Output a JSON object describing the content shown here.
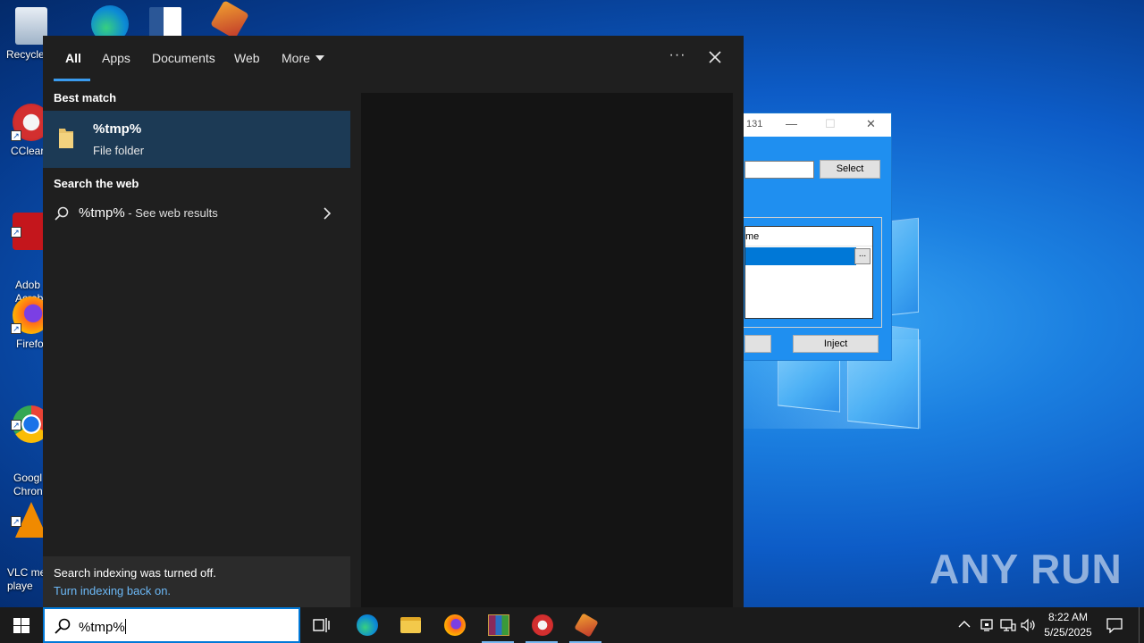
{
  "desktop": {
    "icons": [
      {
        "label": "Recycle"
      },
      {
        "label": "CClear"
      },
      {
        "label": "Adob\nAcrob"
      },
      {
        "label": "Firefo"
      },
      {
        "label": "Googl\nChron"
      },
      {
        "label": "VLC me\nplaye"
      }
    ],
    "watermark": "ANY RUN"
  },
  "dialog": {
    "title_fragment": "131",
    "select_label": "Select",
    "list_header": "me",
    "more_button": "...",
    "inject_label": "Inject"
  },
  "search": {
    "tabs": [
      "All",
      "Apps",
      "Documents",
      "Web",
      "More"
    ],
    "ellipsis": "···",
    "best_match_heading": "Best match",
    "best_match": {
      "title": "%tmp%",
      "subtitle": "File folder"
    },
    "web_heading": "Search the web",
    "web_result": {
      "query": "%tmp%",
      "suffix": " - See web results"
    },
    "indexing_message": "Search indexing was turned off.",
    "indexing_link": "Turn indexing back on.",
    "query": "%tmp%"
  },
  "taskbar": {
    "time": "8:22 AM",
    "date": "5/25/2025"
  },
  "colors": {
    "accent": "#0078d7",
    "panel_bg": "#1f1f1f",
    "selected_bg": "#1c3a55",
    "link": "#6cb8f6"
  }
}
